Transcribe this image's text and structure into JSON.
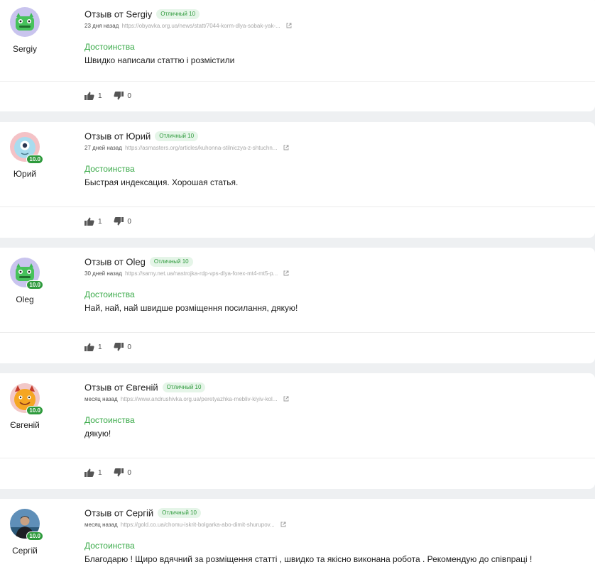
{
  "reviews": [
    {
      "author": "Sergiy",
      "title": "Отзыв от Sergiy",
      "score_label": "Отличный 10",
      "badge": "",
      "avatar_icon": "green-monster-avatar",
      "time": "23 дня назад",
      "link": "https://obyavka.org.ua/news/statt/7044-korm-dlya-sobak-yak-...",
      "section": "Достоинства",
      "text": "Швидко написали статтю і розмістили",
      "likes": "1",
      "dislikes": "0"
    },
    {
      "author": "Юрий",
      "title": "Отзыв от Юрий",
      "score_label": "Отличный 10",
      "badge": "10.0",
      "avatar_icon": "blue-cyclops-avatar",
      "time": "27 дней назад",
      "link": "https://asmasters.org/articles/kuhonna-stilniczya-z-shtuchn...",
      "section": "Достоинства",
      "text": "Быстрая индексация. Хорошая статья.",
      "likes": "1",
      "dislikes": "0"
    },
    {
      "author": "Oleg",
      "title": "Отзыв от Oleg",
      "score_label": "Отличный 10",
      "badge": "10.0",
      "avatar_icon": "green-monster-avatar",
      "time": "30 дней назад",
      "link": "https://sarny.net.ua/nastrojka-rdp-vps-dlya-forex-mt4-mt5-p...",
      "section": "Достоинства",
      "text": "Най, най, най швидше розміщення посилання, дякую!",
      "likes": "1",
      "dislikes": "0"
    },
    {
      "author": "Євгеній",
      "title": "Отзыв от Євгеній",
      "score_label": "Отличный 10",
      "badge": "10.0",
      "avatar_icon": "orange-horned-monster-avatar",
      "time": "месяц назад",
      "link": "https://www.andrushivka.org.ua/peretyazhka-mebliv-kiyiv-kol...",
      "section": "Достоинства",
      "text": "дякую!",
      "likes": "1",
      "dislikes": "0"
    },
    {
      "author": "Сергій",
      "title": "Отзыв от Сергій",
      "score_label": "Отличный 10",
      "badge": "10.0",
      "avatar_icon": "user-photo-avatar",
      "time": "месяц назад",
      "link": "https://gold.co.ua/chomu-iskrit-bolgarka-abo-dimit-shurupov...",
      "section": "Достоинства",
      "text": "Благодарю ! Щиро вдячний за розміщення статті , швидко та якісно виконана робота . Рекомендую до співпраці !",
      "likes": "",
      "dislikes": ""
    }
  ],
  "colors": {
    "accent_green": "#3aaa49",
    "badge_green": "#2e9a3c",
    "pill_bg": "#e5f5e8",
    "page_bg": "#eef0f2"
  }
}
